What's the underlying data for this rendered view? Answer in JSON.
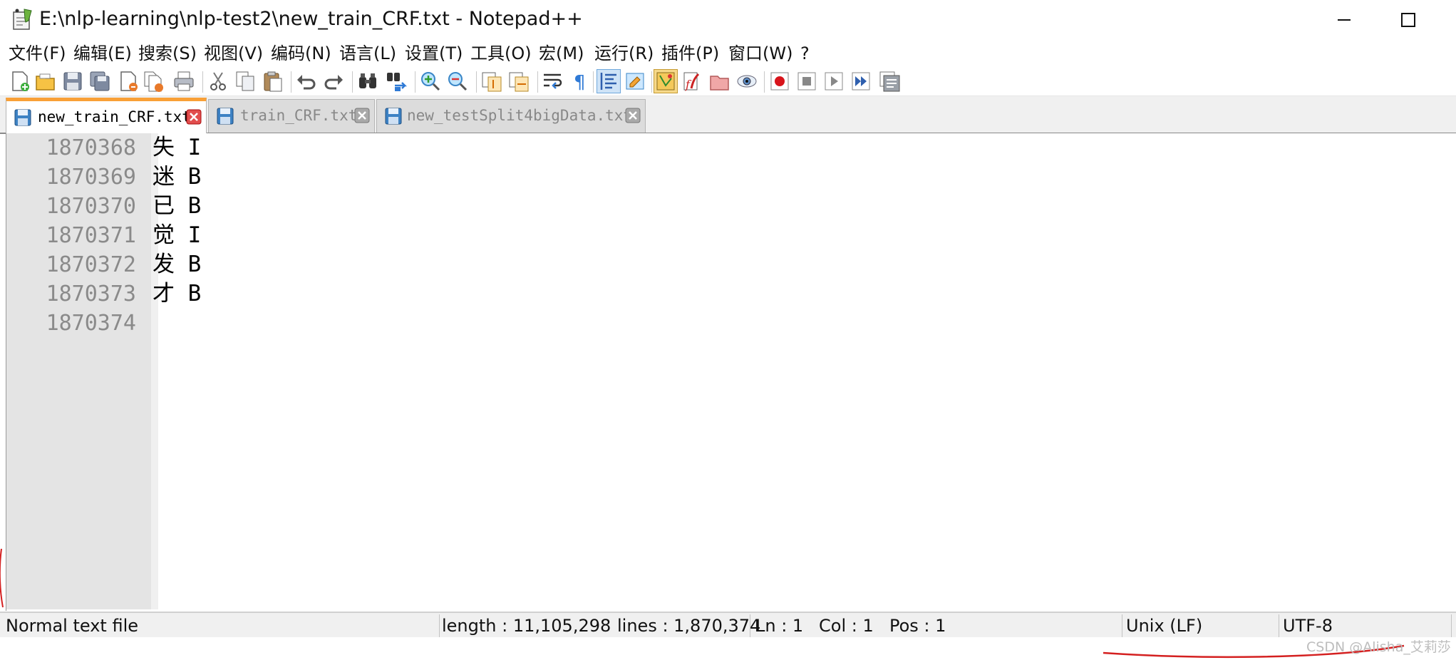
{
  "window": {
    "title": "E:\\nlp-learning\\nlp-test2\\new_train_CRF.txt - Notepad++",
    "minimize_glyph": "—",
    "maximize_glyph": "☐"
  },
  "menu": [
    {
      "label": "文件(F)"
    },
    {
      "label": "编辑(E)"
    },
    {
      "label": "搜索(S)"
    },
    {
      "label": "视图(V)"
    },
    {
      "label": "编码(N)"
    },
    {
      "label": "语言(L)"
    },
    {
      "label": "设置(T)"
    },
    {
      "label": "工具(O)"
    },
    {
      "label": "宏(M)"
    },
    {
      "label": "运行(R)"
    },
    {
      "label": "插件(P)"
    },
    {
      "label": "窗口(W)"
    },
    {
      "label": "?"
    }
  ],
  "toolbar": {
    "icons": [
      "new-file-icon",
      "open-file-icon",
      "save-icon",
      "save-all-icon",
      "close-icon",
      "close-all-icon",
      "print-icon",
      "cut-icon",
      "copy-icon",
      "paste-icon",
      "undo-icon",
      "redo-icon",
      "find-icon",
      "replace-icon",
      "zoom-in-icon",
      "zoom-out-icon",
      "sync-vertical-icon",
      "sync-horizontal-icon",
      "word-wrap-icon",
      "show-all-chars-icon",
      "indent-guide-icon",
      "user-language-icon",
      "doc-map-icon",
      "function-list-icon",
      "folder-workspace-icon",
      "monitor-icon",
      "record-macro-icon",
      "stop-macro-icon",
      "play-macro-icon",
      "run-macro-multiple-icon",
      "save-macro-icon"
    ]
  },
  "tabs": [
    {
      "label": "new_train_CRF.txt",
      "active": true
    },
    {
      "label": "train_CRF.txt",
      "active": false
    },
    {
      "label": "new_testSplit4bigData.txt",
      "active": false
    }
  ],
  "editor": {
    "lines": [
      {
        "number": "1870368",
        "text": "失 I"
      },
      {
        "number": "1870369",
        "text": "迷 B"
      },
      {
        "number": "1870370",
        "text": "已 B"
      },
      {
        "number": "1870371",
        "text": "觉 I"
      },
      {
        "number": "1870372",
        "text": "发 B"
      },
      {
        "number": "1870373",
        "text": "才 B"
      },
      {
        "number": "1870374",
        "text": ""
      }
    ]
  },
  "status": {
    "file_type": "Normal text file",
    "length": "length : 11,105,298",
    "lines": "lines : 1,870,374",
    "ln": "Ln : 1",
    "col": "Col : 1",
    "pos": "Pos : 1",
    "eol": "Unix (LF)",
    "encoding": "UTF-8"
  },
  "watermark": "CSDN @Alisha_艾莉莎",
  "colors": {
    "active_tab_accent": "#f9a037",
    "gutter_bg": "#e4e4e4",
    "line_number": "#8a8a8a",
    "annotation_red": "#d42020"
  }
}
